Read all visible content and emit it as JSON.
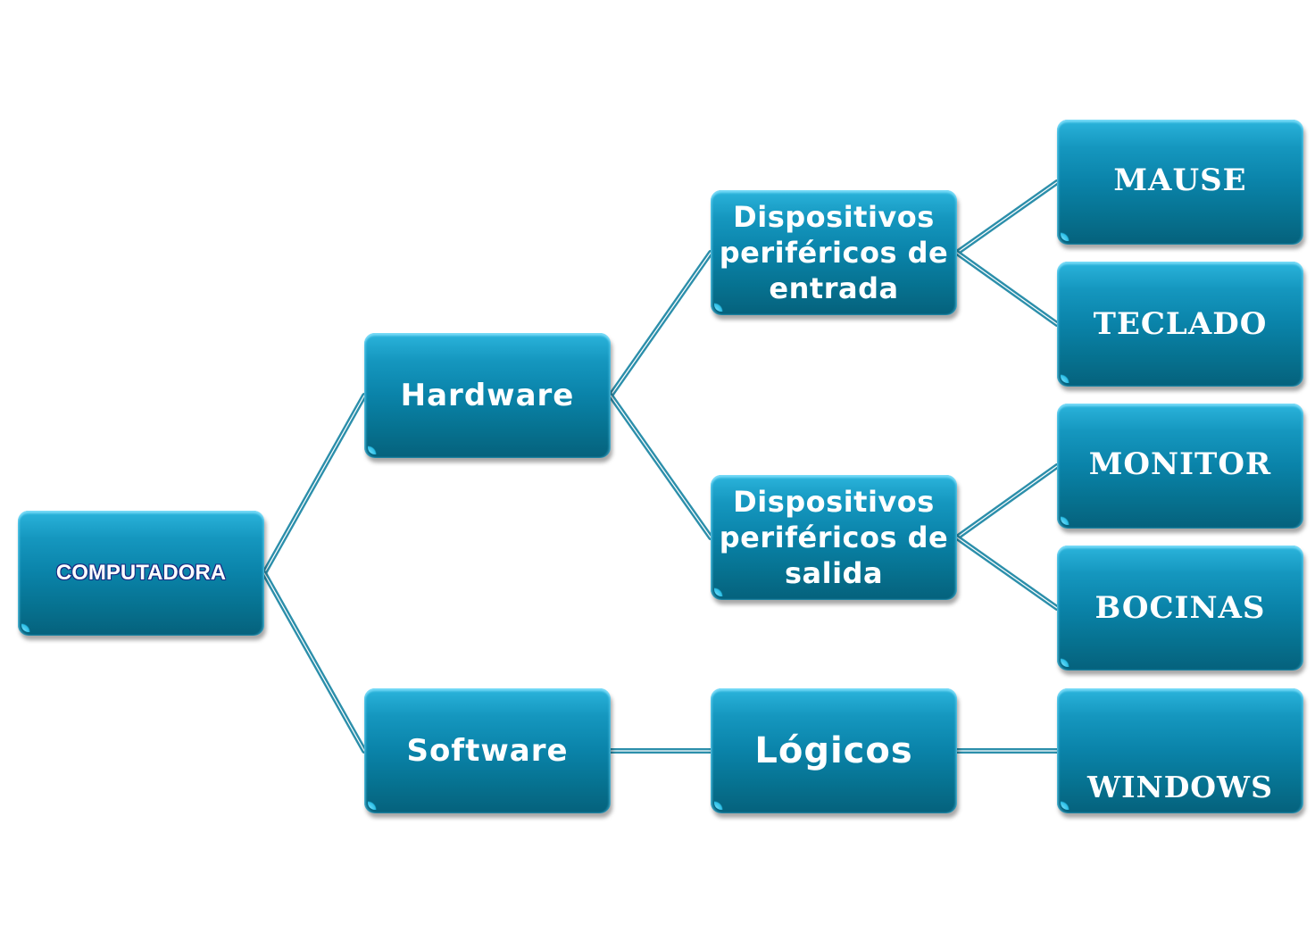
{
  "diagram": {
    "type": "tree",
    "colors": {
      "node_fill": "#0a83a9",
      "node_top": "#2bb4dc",
      "node_bottom": "#05617c",
      "connector": "#2c8fab",
      "text": "#ffffff"
    },
    "nodes": {
      "root": {
        "label": "COMPUTADORA"
      },
      "hardware": {
        "label": "Hardware",
        "parent": "root"
      },
      "software": {
        "label": "Software",
        "parent": "root"
      },
      "entrada": {
        "line1": "Dispositivos",
        "line2": "periféricos de",
        "line3": "entrada",
        "parent": "hardware"
      },
      "salida": {
        "line1": "Dispositivos",
        "line2": "periféricos de",
        "line3": "salida",
        "parent": "hardware"
      },
      "logicos": {
        "label": "Lógicos",
        "parent": "software"
      },
      "mause": {
        "label": "MAUSE",
        "parent": "entrada"
      },
      "teclado": {
        "label": "TECLADO",
        "parent": "entrada"
      },
      "monitor": {
        "label": "MONITOR",
        "parent": "salida"
      },
      "bocinas": {
        "label": "BOCINAS",
        "parent": "salida"
      },
      "windows": {
        "label": "WINDOWS",
        "parent": "logicos"
      }
    }
  }
}
